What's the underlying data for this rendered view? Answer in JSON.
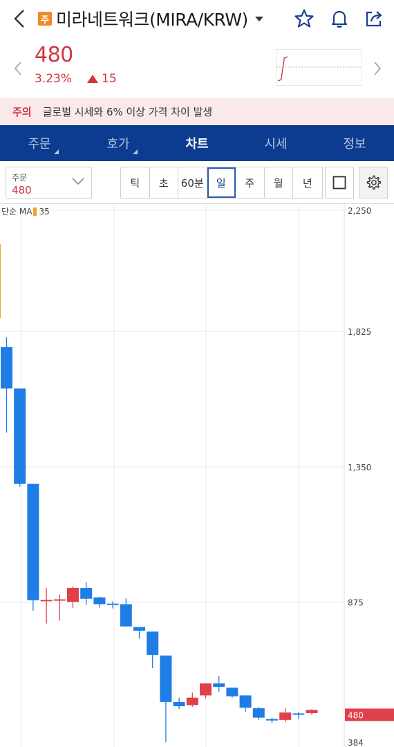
{
  "header": {
    "badge": "주",
    "title": "미라네트워크(MIRA/KRW)"
  },
  "price": {
    "current": "480",
    "change_pct": "3.23%",
    "change_amount": "15",
    "sparkline": [
      0.05,
      0.1,
      0.9,
      0.95
    ]
  },
  "warning": {
    "label": "주의",
    "text": "글로벌 시세와 6% 이상 가격 차이 발생"
  },
  "tabs": [
    {
      "label": "주문",
      "active": false
    },
    {
      "label": "호가",
      "active": false
    },
    {
      "label": "차트",
      "active": true
    },
    {
      "label": "시세",
      "active": false
    },
    {
      "label": "정보",
      "active": false
    }
  ],
  "toolbar": {
    "select_label": "주문",
    "select_value": "480",
    "periods": [
      "틱",
      "초",
      "60분",
      "일",
      "주",
      "월",
      "년"
    ],
    "active_period": "일"
  },
  "colors": {
    "up": "#e0404b",
    "down": "#1f7de6",
    "tab_bg": "#0c3c8f",
    "accent_red": "#d0353f"
  },
  "chart_data": {
    "type": "candlestick",
    "indicator": {
      "name": "단순 MA",
      "period": "35"
    },
    "y_ticks": [
      2250,
      1825,
      1350,
      875,
      384
    ],
    "ylim": [
      384,
      2250
    ],
    "current_price_label": "480",
    "candles": [
      {
        "o": 1770,
        "h": 1805,
        "l": 1470,
        "c": 1625
      },
      {
        "o": 1625,
        "h": 1625,
        "l": 1280,
        "c": 1290
      },
      {
        "o": 1290,
        "h": 1290,
        "l": 845,
        "c": 882
      },
      {
        "o": 880,
        "h": 925,
        "l": 800,
        "c": 883
      },
      {
        "o": 885,
        "h": 902,
        "l": 810,
        "c": 885
      },
      {
        "o": 876,
        "h": 930,
        "l": 855,
        "c": 925
      },
      {
        "o": 925,
        "h": 945,
        "l": 865,
        "c": 887
      },
      {
        "o": 892,
        "h": 894,
        "l": 856,
        "c": 868
      },
      {
        "o": 870,
        "h": 878,
        "l": 853,
        "c": 866
      },
      {
        "o": 868,
        "h": 888,
        "l": 805,
        "c": 790
      },
      {
        "o": 788,
        "h": 788,
        "l": 747,
        "c": 775
      },
      {
        "o": 772,
        "h": 772,
        "l": 644,
        "c": 690
      },
      {
        "o": 688,
        "h": 688,
        "l": 384,
        "c": 525
      },
      {
        "o": 525,
        "h": 540,
        "l": 500,
        "c": 510
      },
      {
        "o": 514,
        "h": 558,
        "l": 508,
        "c": 540
      },
      {
        "o": 548,
        "h": 588,
        "l": 538,
        "c": 590
      },
      {
        "o": 590,
        "h": 617,
        "l": 561,
        "c": 578
      },
      {
        "o": 575,
        "h": 575,
        "l": 540,
        "c": 545
      },
      {
        "o": 548,
        "h": 548,
        "l": 490,
        "c": 505
      },
      {
        "o": 503,
        "h": 508,
        "l": 462,
        "c": 470
      },
      {
        "o": 465,
        "h": 470,
        "l": 450,
        "c": 460
      },
      {
        "o": 462,
        "h": 503,
        "l": 455,
        "c": 488
      },
      {
        "o": 485,
        "h": 490,
        "l": 466,
        "c": 484
      },
      {
        "o": 486,
        "h": 500,
        "l": 480,
        "c": 497
      }
    ]
  }
}
